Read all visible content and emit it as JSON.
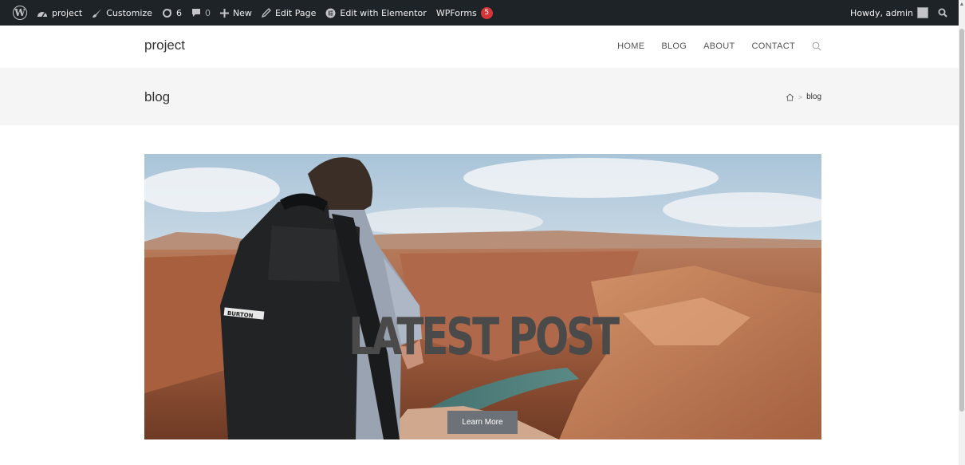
{
  "admin_bar": {
    "site_name": "project",
    "customize": "Customize",
    "updates_count": "6",
    "comments_count": "0",
    "new": "New",
    "edit_page": "Edit Page",
    "edit_elementor": "Edit with Elementor",
    "wpforms": "WPForms",
    "wpforms_badge": "5",
    "howdy": "Howdy, admin"
  },
  "header": {
    "site_title": "project",
    "nav": [
      "HOME",
      "BLOG",
      "ABOUT",
      "CONTACT"
    ]
  },
  "page": {
    "title": "blog",
    "breadcrumb_current": "blog"
  },
  "hero": {
    "title": "LATEST POST",
    "button_label": "Learn More",
    "backpack_text": "BURTON"
  },
  "colors": {
    "admin_bar_bg": "#1d2327",
    "page_band_bg": "#f5f5f5",
    "button_bg": "#6d7278",
    "badge": "#d63638"
  }
}
